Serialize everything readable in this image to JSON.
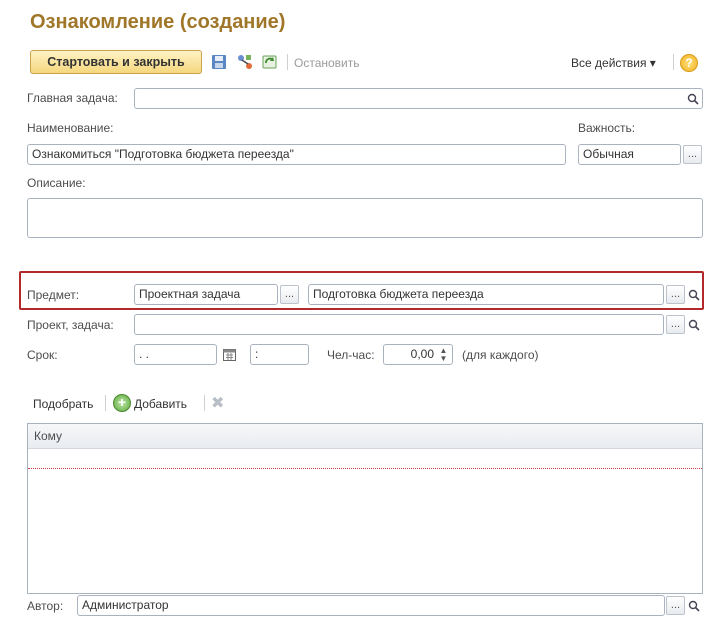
{
  "window": {
    "title": "Ознакомление (создание)"
  },
  "toolbar": {
    "start_close_label": "Стартовать и закрыть",
    "stop_label": "Остановить",
    "all_actions_label": "Все действия ▾",
    "help_label": "?"
  },
  "form": {
    "main_task": {
      "label": "Главная задача:",
      "value": ""
    },
    "name": {
      "label": "Наименование:",
      "value": "Ознакомиться \"Подготовка бюджета переезда\""
    },
    "importance": {
      "label": "Важность:",
      "value": "Обычная"
    },
    "description": {
      "label": "Описание:",
      "value": ""
    },
    "subject": {
      "label": "Предмет:",
      "type_value": "Проектная задача",
      "value": "Подготовка бюджета переезда"
    },
    "project_task": {
      "label": "Проект, задача:",
      "value": ""
    },
    "deadline": {
      "label": "Срок:",
      "date_value": " . .",
      "time_value": " :"
    },
    "man_hours": {
      "label": "Чел-час:",
      "value": "0,00",
      "suffix": "(для каждого)"
    }
  },
  "list_toolbar": {
    "pick_label": "Подобрать",
    "add_label": "Добавить"
  },
  "grid": {
    "column_header": "Кому",
    "rows": []
  },
  "footer": {
    "author": {
      "label": "Автор:",
      "value": "Администратор"
    }
  },
  "icons": {
    "save": "save-icon",
    "routing": "routing-icon",
    "refresh": "refresh-icon",
    "search": "search-icon",
    "calendar": "calendar-icon",
    "add": "add-icon",
    "delete": "delete-icon"
  },
  "colors": {
    "title": "#a07628",
    "highlight_border": "#b32828",
    "accent_button": "#f5d77e"
  }
}
